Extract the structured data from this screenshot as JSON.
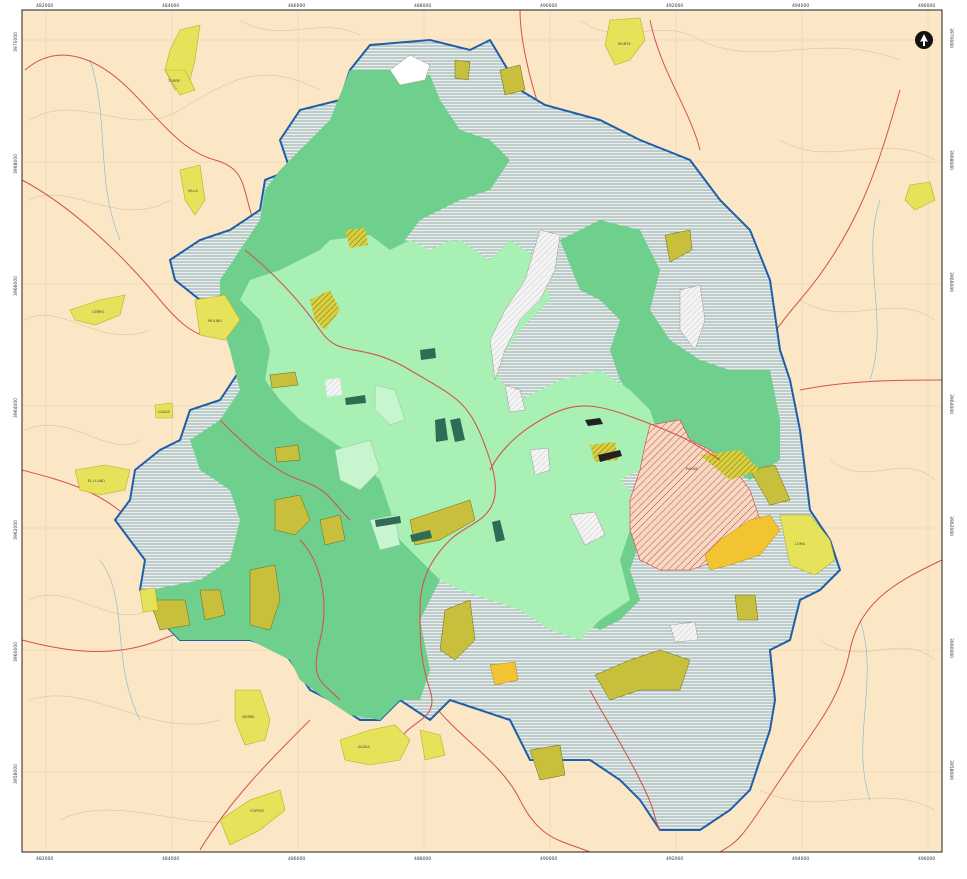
{
  "map": {
    "colors": {
      "background": "#fbe6c5",
      "outer_frame": "#ffffff",
      "neatline": "#222222",
      "boundary": "#1f5ea8",
      "hatch_background": "#e9efed",
      "hatch_line": "#6d8c8c",
      "forest_green": "#6fcf8d",
      "light_green": "#a8f0b4",
      "pale_green": "#c6f5d0",
      "dark_green_patch": "#2f6b55",
      "yellow_area": "#e6e25a",
      "yellow_olive": "#c8bf3c",
      "orange_yellow": "#f2c431",
      "red_hatch": "#d6423a",
      "road_red": "#d4544a",
      "contour": "#c9b38f",
      "stream": "#7fb6d6",
      "white_hatch": "#ffffff"
    },
    "icons": {
      "north_arrow": "north-arrow-icon"
    },
    "top_ticks": [
      "482000",
      "484000",
      "486000",
      "488000",
      "490000",
      "492000",
      "494000",
      "496000"
    ],
    "bottom_ticks": [
      "482000",
      "484000",
      "486000",
      "488000",
      "490000",
      "492000",
      "494000",
      "496000"
    ],
    "left_ticks": [
      "3970000",
      "3968000",
      "3966000",
      "3964000",
      "3962000",
      "3960000",
      "3958000"
    ],
    "right_ticks": [
      "3970000",
      "3968000",
      "3966000",
      "3964000",
      "3962000",
      "3960000",
      "3958000"
    ]
  }
}
